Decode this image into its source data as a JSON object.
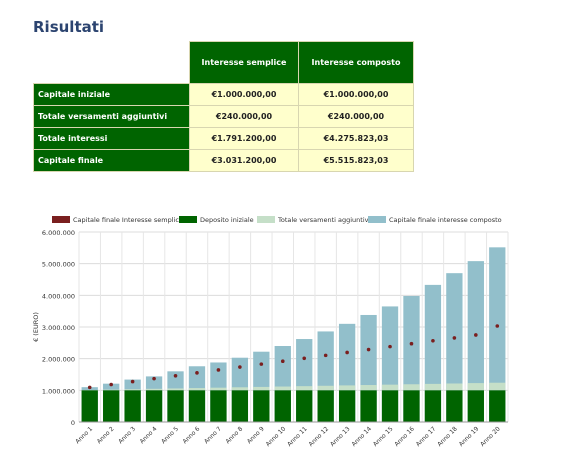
{
  "title": "Risultati",
  "table": {
    "columns": [
      "Interesse semplice",
      "Interesse composto"
    ],
    "rows": [
      {
        "label": "Capitale iniziale",
        "semplice": "€1.000.000,00",
        "composto": "€1.000.000,00"
      },
      {
        "label": "Totale versamenti aggiuntivi",
        "semplice": "€240.000,00",
        "composto": "€240.000,00"
      },
      {
        "label": "Totale interessi",
        "semplice": "€1.791.200,00",
        "composto": "€4.275.823,03"
      },
      {
        "label": "Capitale finale",
        "semplice": "€3.031.200,00",
        "composto": "€5.515.823,03"
      }
    ]
  },
  "colors": {
    "simple_dot": "#7a1f1f",
    "deposit": "#006400",
    "versamenti": "#c5dfc8",
    "composto": "#92bfcb"
  },
  "chart_data": {
    "type": "bar",
    "stacked": true,
    "ylabel": "€ (EURO)",
    "xlabel": "",
    "ylim": [
      0,
      6000000
    ],
    "yticks": [
      0,
      1000000,
      2000000,
      3000000,
      4000000,
      5000000,
      6000000
    ],
    "ytick_labels": [
      "0",
      "1.000.000",
      "2.000.000",
      "3.000.000",
      "4.000.000",
      "5.000.000",
      "6.000.000"
    ],
    "grid": true,
    "legend_position": "top",
    "categories": [
      "Anno 1",
      "Anno 2",
      "Anno 3",
      "Anno 4",
      "Anno 5",
      "Anno 6",
      "Anno 7",
      "Anno 8",
      "Anno 9",
      "Anno 10",
      "Anno 11",
      "Anno 12",
      "Anno 13",
      "Anno 14",
      "Anno 15",
      "Anno 16",
      "Anno 17",
      "Anno 18",
      "Anno 19",
      "Anno 20"
    ],
    "series": [
      {
        "name": "Capitale finale Interesse semplice",
        "kind": "dot",
        "values": [
          1092000,
          1184000,
          1276000,
          1368000,
          1460000,
          1552000,
          1644000,
          1736000,
          1828000,
          1920000,
          2012000,
          2104000,
          2196000,
          2288000,
          2380000,
          2472000,
          2564000,
          2656000,
          2748000,
          3031200
        ]
      },
      {
        "name": "Deposito iniziale",
        "kind": "bar",
        "values": [
          1000000,
          1000000,
          1000000,
          1000000,
          1000000,
          1000000,
          1000000,
          1000000,
          1000000,
          1000000,
          1000000,
          1000000,
          1000000,
          1000000,
          1000000,
          1000000,
          1000000,
          1000000,
          1000000,
          1000000
        ]
      },
      {
        "name": "Totale versamenti aggiuntivi",
        "kind": "bar",
        "values": [
          12000,
          24000,
          36000,
          48000,
          60000,
          72000,
          84000,
          96000,
          108000,
          120000,
          132000,
          144000,
          156000,
          168000,
          180000,
          192000,
          204000,
          216000,
          228000,
          240000
        ]
      },
      {
        "name": "Capitale finale interesse composto",
        "kind": "bar",
        "values": [
          1100000,
          1210000,
          1340000,
          1440000,
          1600000,
          1760000,
          1880000,
          2030000,
          2220000,
          2400000,
          2620000,
          2860000,
          3100000,
          3380000,
          3650000,
          3980000,
          4330000,
          4700000,
          5080000,
          5515823
        ]
      }
    ]
  }
}
